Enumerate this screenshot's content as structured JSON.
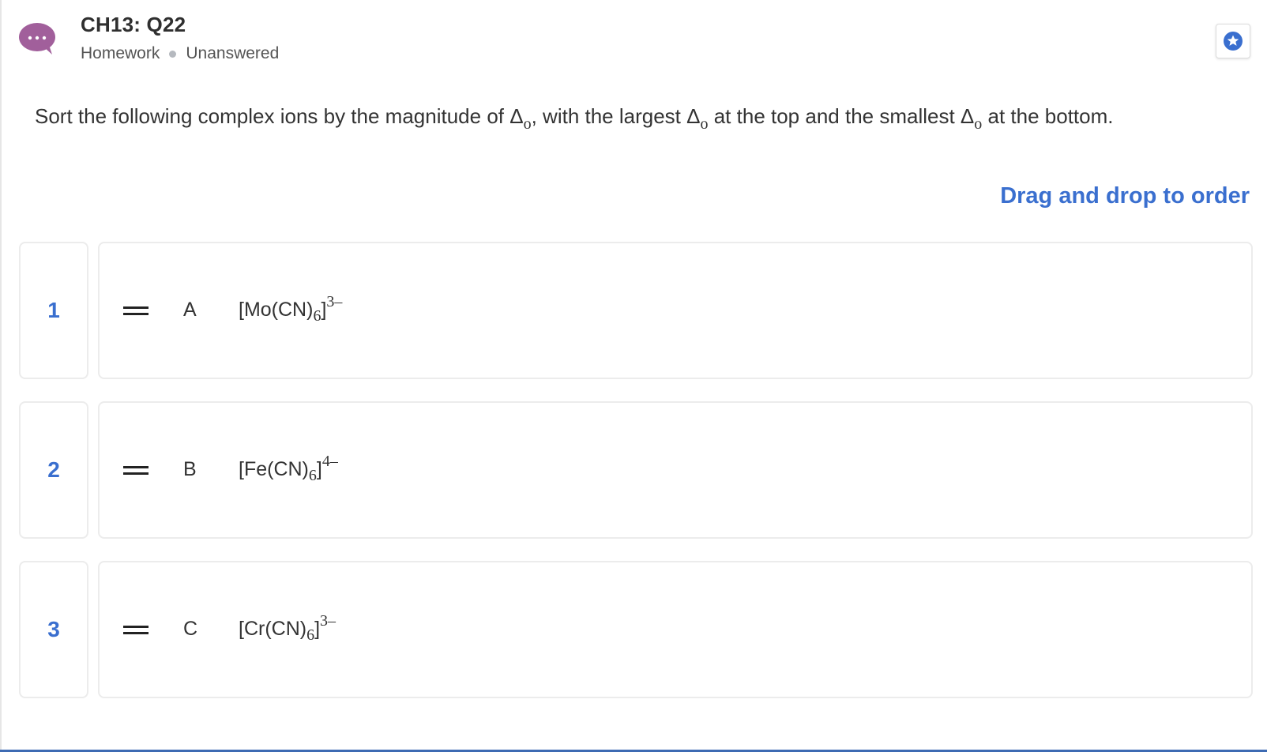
{
  "header": {
    "title": "CH13: Q22",
    "category": "Homework",
    "status": "Unanswered",
    "avatar_icon": "chat-bubble-ellipsis-icon",
    "avatar_color": "#a15f9b",
    "favorite_icon": "star-badge-icon",
    "accent_color": "#3a6fcf"
  },
  "prompt": {
    "p1": "Sort the following complex ions by the magnitude of Δ",
    "s1": "o",
    "p2": ", with the largest Δ",
    "s2": "o",
    "p3": " at the top and the smallest Δ",
    "s3": "o",
    "p4": " at the bottom."
  },
  "instruction": "Drag and drop to order",
  "rows": [
    {
      "rank": "1",
      "letter": "A",
      "metal": "[Mo(CN)",
      "sub": "6",
      "bracket": "]",
      "charge": "3–"
    },
    {
      "rank": "2",
      "letter": "B",
      "metal": "[Fe(CN)",
      "sub": "6",
      "bracket": "]",
      "charge": "4–"
    },
    {
      "rank": "3",
      "letter": "C",
      "metal": "[Cr(CN)",
      "sub": "6",
      "bracket": "]",
      "charge": "3–"
    }
  ]
}
